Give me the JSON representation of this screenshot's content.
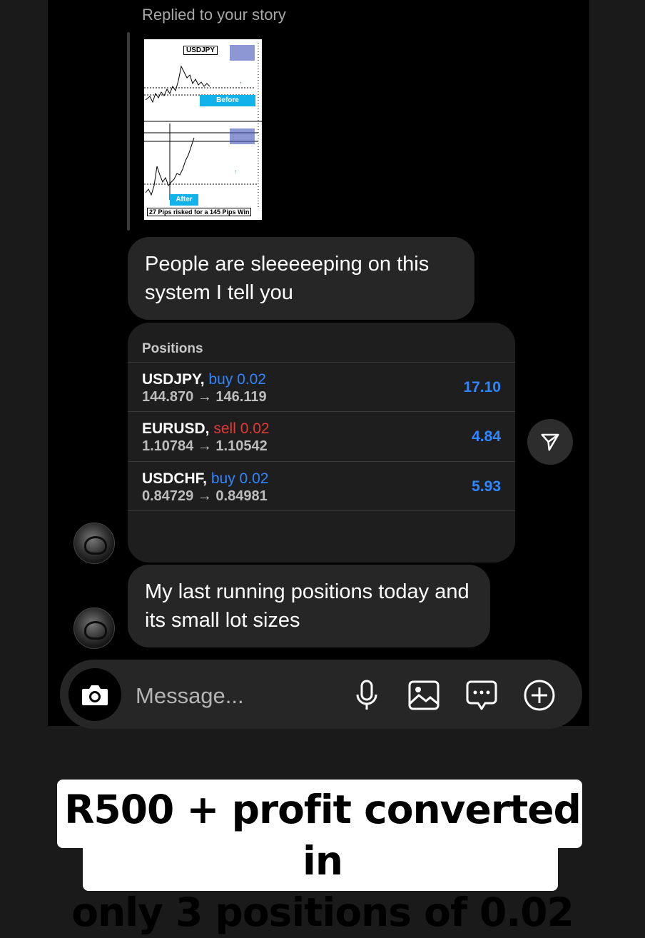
{
  "reply": {
    "label": "Replied to your story"
  },
  "story": {
    "symbol": "USDJPY",
    "before_label": "Before",
    "after_label": "After",
    "caption": "27 Pips risked for a 145 Pips Win"
  },
  "messages": [
    {
      "text": "People are sleeeeeping on this system I tell you"
    },
    {
      "text": "My last running positions today and its small lot sizes"
    }
  ],
  "positions": {
    "header": "Positions",
    "rows": [
      {
        "symbol": "USDJPY,",
        "side": "buy 0.02",
        "side_color": "#2f86ff",
        "open": "144.870",
        "arrow": "→",
        "current": "146.119",
        "profit": "17.10"
      },
      {
        "symbol": "EURUSD,",
        "side": "sell 0.02",
        "side_color": "#e53935",
        "open": "1.10784",
        "arrow": "→",
        "current": "1.10542",
        "profit": "4.84"
      },
      {
        "symbol": "USDCHF,",
        "side": "buy 0.02",
        "side_color": "#2f86ff",
        "open": "0.84729",
        "arrow": "→",
        "current": "0.84981",
        "profit": "5.93"
      }
    ]
  },
  "composer": {
    "placeholder": "Message...",
    "icons": [
      "camera-icon",
      "microphone-icon",
      "gallery-icon",
      "sticker-icon",
      "plus-icon"
    ]
  },
  "overlay": {
    "line1": "R500 + profit converted in",
    "line2": "only 3 positions of 0.02"
  },
  "colors": {
    "buy": "#2f86ff",
    "sell": "#e53935",
    "bubble": "#262626",
    "accent": "#12b3ea"
  }
}
